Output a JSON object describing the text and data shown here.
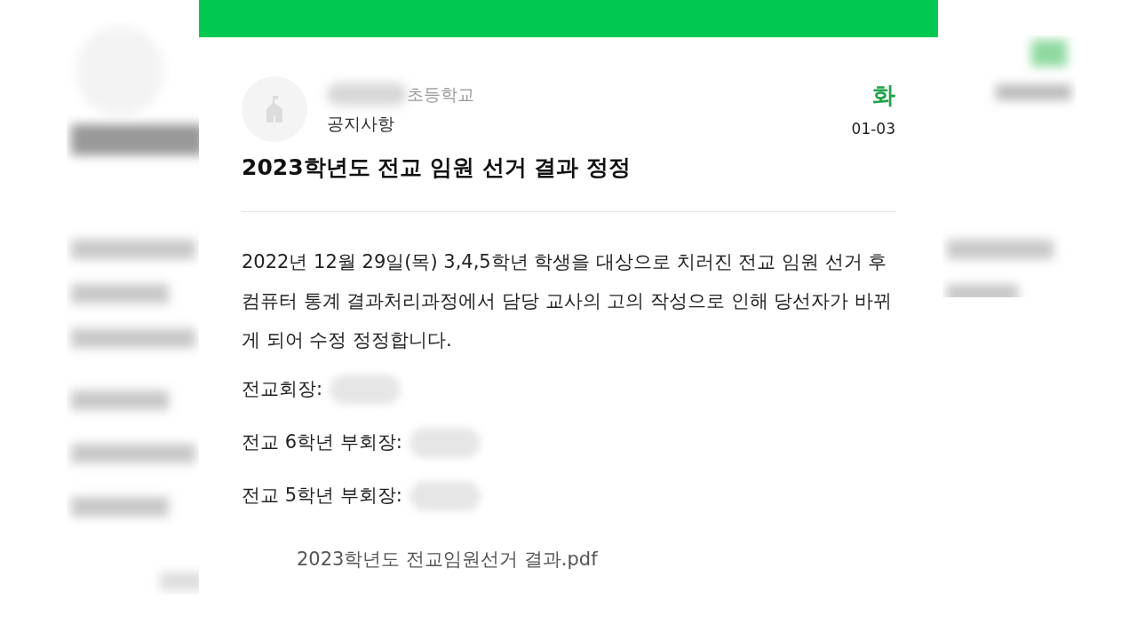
{
  "header": {
    "school": "초등학교",
    "board": "공지사항",
    "weekday": "화",
    "date": "01-03"
  },
  "title": "2023학년도 전교 임원 선거 결과 정정",
  "body": "2022년 12월 29일(목) 3,4,5학년 학생을 대상으로 치러진 전교 임원 선거 후 컴퓨터 통계 결과처리과정에서 담당 교사의 고의 작성으로 인해 당선자가 바뀌게 되어 수정 정정합니다.",
  "results": [
    {
      "label": "전교회장:"
    },
    {
      "label": "전교 6학년 부회장:"
    },
    {
      "label": "전교 5학년 부회장:"
    }
  ],
  "attachment": "2023학년도 전교임원선거 결과.pdf"
}
